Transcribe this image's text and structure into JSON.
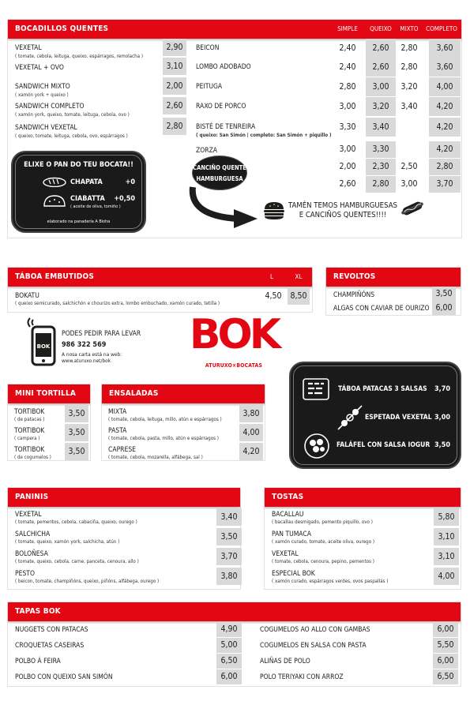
{
  "bocadillos": {
    "title": "BOCADILLOS QUENTES",
    "cols": [
      "SIMPLE",
      "QUEIXO",
      "MIXTO",
      "COMPLETO"
    ],
    "left": [
      {
        "name": "VEXETAL",
        "desc": "( tomate, cebola, leituga, queixo, espárragos, remolacha )",
        "price": "2,90"
      },
      {
        "name": "VEXETAL + OVO",
        "desc": "",
        "price": "3,10"
      },
      {
        "name": "SANDWICH MIXTO",
        "desc": "( xamón york + queixo )",
        "price": "2,00"
      },
      {
        "name": "SANDWICH COMPLETO",
        "desc": "( xamón york, queixo, tomate, leituga, cebola, ovo )",
        "price": "2,60"
      },
      {
        "name": "SANDWICH VEXETAL",
        "desc": "( queixo, tomate, leituga, cebola, ovo, espárragos )",
        "price": "2,80"
      }
    ],
    "right": [
      {
        "name": "BEICON",
        "desc": "",
        "prices": [
          "2,40",
          "2,60",
          "2,80",
          "3,60"
        ]
      },
      {
        "name": "LOMBO ADOBADO",
        "desc": "",
        "prices": [
          "2,40",
          "2,60",
          "2,80",
          "3,60"
        ]
      },
      {
        "name": "PEITUGA",
        "desc": "",
        "prices": [
          "2,80",
          "3,00",
          "3,20",
          "4,00"
        ]
      },
      {
        "name": "RAXO DE PORCO",
        "desc": "",
        "prices": [
          "3,00",
          "3,20",
          "3,40",
          "4,20"
        ]
      },
      {
        "name": "BISTÉ DE TENREIRA",
        "desc": "( queixo: San Simón | completo: San Simón + piquillo )",
        "prices": [
          "3,30",
          "3,40",
          "",
          "4,20"
        ]
      },
      {
        "name": "ZORZA",
        "desc": "",
        "prices": [
          "3,00",
          "3,30",
          "",
          "4,20"
        ]
      },
      {
        "name": "CANCIÑO QUENTE",
        "desc": "",
        "prices": [
          "2,00",
          "2,30",
          "2,50",
          "2,80"
        ]
      },
      {
        "name": "HAMBURGUESA",
        "desc": "",
        "prices": [
          "2,60",
          "2,80",
          "3,00",
          "3,70"
        ]
      }
    ],
    "bread": {
      "title": "ELIXE O PAN DO TEU BOCATA!!",
      "opt1": "CHAPATA",
      "opt1_price": "+0",
      "opt2": "CIABATTA",
      "opt2_price": "+0,50",
      "opt2_note": "( aceite de oliva, tomiño )",
      "footer": "elaborado na panadería A Bioha"
    },
    "promo": "TAMÉN TEMOS HAMBURGUESAS\nE CANCIÑOS QUENTES!!!!"
  },
  "taboa": {
    "title": "TÁBOA EMBUTIDOS",
    "cols": [
      "L",
      "XL"
    ],
    "item": {
      "name": "BOKATU",
      "desc": "( queixo semicurado, salchichón e chourizo extra, lombo embuchado, xamón curado, tetilla )",
      "price_l": "4,50",
      "price_xl": "8,50"
    }
  },
  "revoltos": {
    "title": "REVOLTOS",
    "items": [
      {
        "name": "CHAMPIÑÓNS",
        "price": "3,50"
      },
      {
        "name": "ALGAS CON CAVIAR DE OURIZO",
        "price": "6,00"
      }
    ]
  },
  "contact": {
    "line1": "PODES PEDIR PARA LEVAR",
    "phone": "986 322 569",
    "line3": "A nosa carta está na web:",
    "web": "www.aturuxo.net/bok",
    "phone_screen": "BOK"
  },
  "logo": {
    "text": "BOK",
    "tagline": "ATURUXO×BOCATAS"
  },
  "board2": {
    "items": [
      {
        "name": "TÁBOA PATACAS 3 SALSAS",
        "price": "3,70"
      },
      {
        "name": "ESPETADA VEXETAL",
        "price": "3,00"
      },
      {
        "name": "FALÁFEL CON SALSA IOGUR",
        "price": "3,50"
      }
    ]
  },
  "mini": {
    "title": "MINI TORTILLA",
    "items": [
      {
        "name": "TORTIBOK",
        "desc": "( de patacas )",
        "price": "3,50"
      },
      {
        "name": "TORTIBOK",
        "desc": "( campera )",
        "price": "3,50"
      },
      {
        "name": "TORTIBOK",
        "desc": "( de cogumelos )",
        "price": "3,50"
      }
    ]
  },
  "ensaladas": {
    "title": "ENSALADAS",
    "items": [
      {
        "name": "MIXTA",
        "desc": "( tomate, cebola, leituga, millo, atún e espárragos )",
        "price": "3,80"
      },
      {
        "name": "PASTA",
        "desc": "( tomate, cebola, pasta, millo, atún e espárragos )",
        "price": "4,00"
      },
      {
        "name": "CAPRESE",
        "desc": "( tomate, cebola, mozarella, alfábega, sal )",
        "price": "4,20"
      }
    ]
  },
  "paninis": {
    "title": "PANINIS",
    "items": [
      {
        "name": "VEXETAL",
        "desc": "( tomate, pementos, cebola, cabaciña, queixo, ourego )",
        "price": "3,40"
      },
      {
        "name": "SALCHICHA",
        "desc": "( tomate, queixo, xamón york, salchicha, atún )",
        "price": "3,50"
      },
      {
        "name": "BOLOÑESA",
        "desc": "( tomate, queixo, cebola, carne, panceta, cenoura, allo )",
        "price": "3,70"
      },
      {
        "name": "PESTO",
        "desc": "( beicon, tomate, champiñóns, queixo, piñóns, alfábega, ourego )",
        "price": "3,80"
      }
    ]
  },
  "tostas": {
    "title": "TOSTAS",
    "items": [
      {
        "name": "BACALLAU",
        "desc": "( bacallau desmigado, pemento piquillo, ovo )",
        "price": "5,80"
      },
      {
        "name": "PAN TUMACA",
        "desc": "( xamón curado, tomate, aceite oliva, ourego )",
        "price": "3,10"
      },
      {
        "name": "VEXETAL",
        "desc": "( tomate, cebola, cenoura, pepino, pementos )",
        "price": "3,10"
      },
      {
        "name": "ESPECIAL BOK",
        "desc": "( xamón curado, espárragos verdes, ovos paspallás )",
        "price": "4,00"
      }
    ]
  },
  "tapas": {
    "title": "TAPAS BOK",
    "left": [
      {
        "name": "NUGGETS CON PATACAS",
        "price": "4,90"
      },
      {
        "name": "CROQUETAS CASEIRAS",
        "price": "5,00"
      },
      {
        "name": "POLBO Á FEIRA",
        "price": "6,50"
      },
      {
        "name": "POLBO CON QUEIXO SAN SIMÓN",
        "price": "6,00"
      }
    ],
    "right": [
      {
        "name": "COGUMELOS AO ALLO CON GAMBAS",
        "price": "6,00"
      },
      {
        "name": "COGUMELOS EN SALSA CON PASTA",
        "price": "5,50"
      },
      {
        "name": "ALIÑAS DE POLO",
        "price": "6,00"
      },
      {
        "name": "POLO TERIYAKI CON ARROZ",
        "price": "6,50"
      }
    ]
  },
  "colors": {
    "accent": "#e30613",
    "shade": "#d9d9d9",
    "board": "#1a1a1a"
  }
}
